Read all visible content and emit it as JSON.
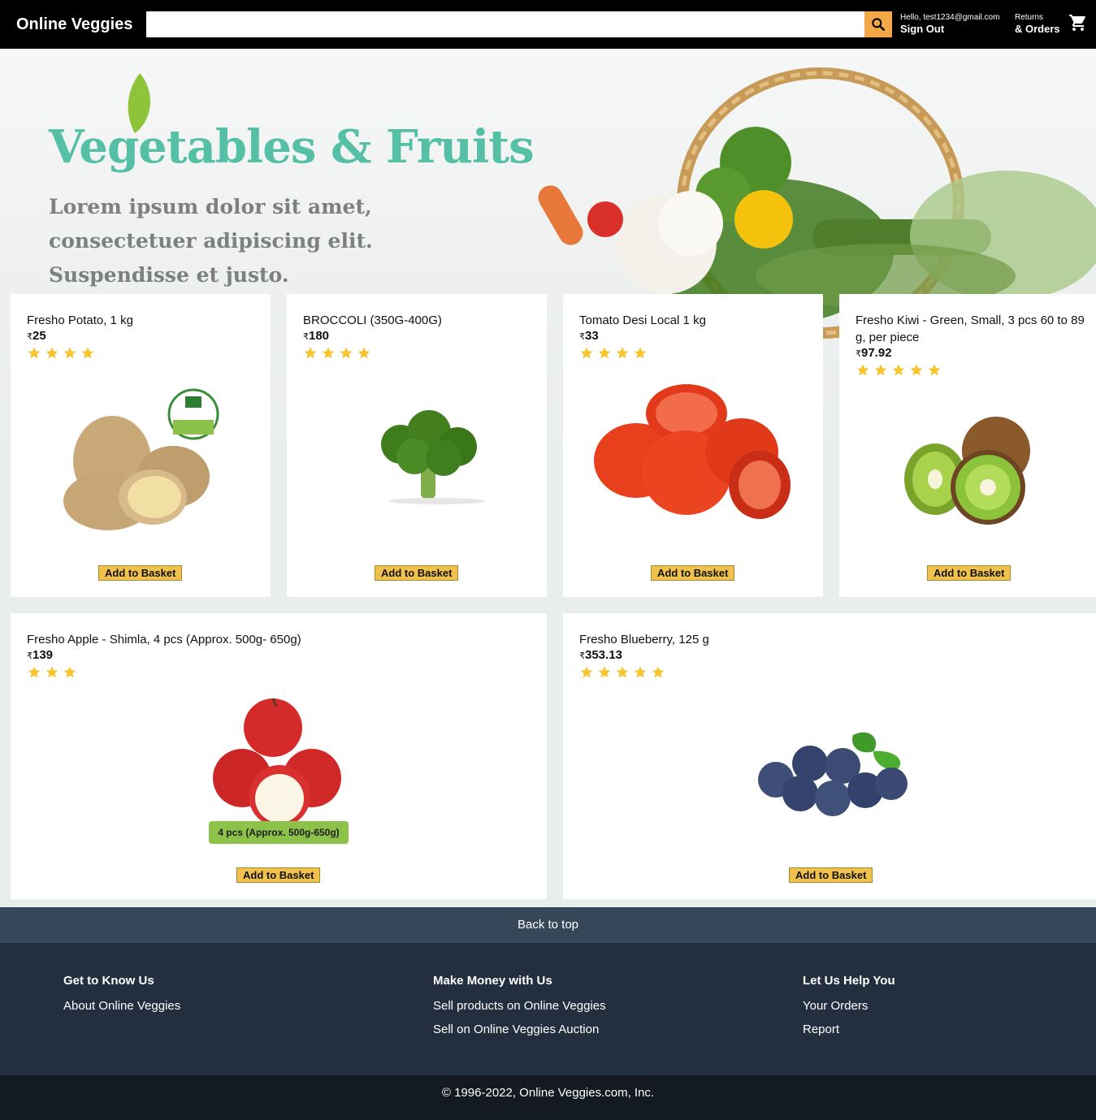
{
  "header": {
    "logo": "Online Veggies",
    "search": {
      "value": "",
      "placeholder": ""
    },
    "user": {
      "greeting": "Hello, test1234@gmail.com",
      "action": "Sign Out"
    },
    "returns": {
      "line1": "Returns",
      "line2": "& Orders"
    }
  },
  "hero": {
    "title": "Vegetables & Fruits",
    "subtitle": "Lorem ipsum dolor sit amet, consectetuer adipiscing elit. Suspendisse et justo."
  },
  "currency": "₹",
  "products": [
    {
      "title": "Fresho Potato, 1 kg",
      "price": "25",
      "rating": 4,
      "button": "Add to Basket"
    },
    {
      "title": "BROCCOLI (350G-400G)",
      "price": "180",
      "rating": 4,
      "button": "Add to Basket"
    },
    {
      "title": "Tomato Desi Local 1 kg",
      "price": "33",
      "rating": 4,
      "button": "Add to Basket"
    },
    {
      "title": "Fresho Kiwi - Green, Small, 3 pcs 60 to 89 g, per piece",
      "price": "97.92",
      "rating": 5,
      "button": "Add to Basket"
    },
    {
      "title": "Fresho Apple - Shimla, 4 pcs (Approx. 500g- 650g)",
      "price": "139",
      "rating": 3,
      "button": "Add to Basket",
      "image_badge": "4 pcs  (Approx. 500g-650g)"
    },
    {
      "title": "Fresho Blueberry, 125 g",
      "price": "353.13",
      "rating": 5,
      "button": "Add to Basket"
    }
  ],
  "footer": {
    "back_to_top": "Back to top",
    "columns": [
      {
        "heading": "Get to Know Us",
        "links": [
          "About Online Veggies"
        ]
      },
      {
        "heading": "Make Money with Us",
        "links": [
          "Sell products on Online Veggies",
          "Sell on Online Veggies Auction"
        ]
      },
      {
        "heading": "Let Us Help You",
        "links": [
          "Your Orders",
          "Report"
        ]
      }
    ],
    "copyright": "© 1996-2022, Online Veggies.com, Inc."
  },
  "colors": {
    "star": "#f7c531",
    "button": "#f0c14b",
    "search_button": "#f3a847",
    "hero_title": "#55c0a6"
  },
  "icons": [
    "search-icon",
    "cart-icon",
    "star-icon"
  ]
}
